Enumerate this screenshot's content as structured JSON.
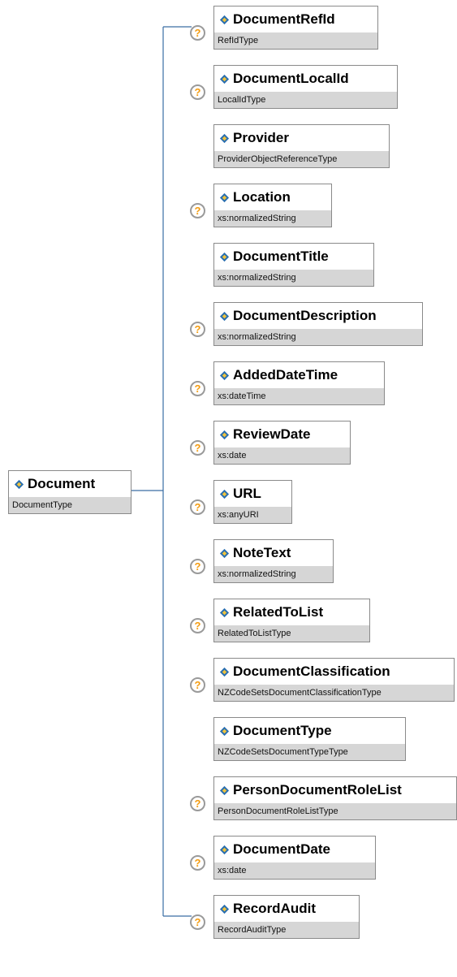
{
  "root": {
    "name": "Document",
    "type": "DocumentType"
  },
  "children": [
    {
      "name": "DocumentRefId",
      "type": "RefIdType",
      "has_annotation": true
    },
    {
      "name": "DocumentLocalId",
      "type": "LocalIdType",
      "has_annotation": true
    },
    {
      "name": "Provider",
      "type": "ProviderObjectReferenceType",
      "has_annotation": false
    },
    {
      "name": "Location",
      "type": "xs:normalizedString",
      "has_annotation": true
    },
    {
      "name": "DocumentTitle",
      "type": "xs:normalizedString",
      "has_annotation": false
    },
    {
      "name": "DocumentDescription",
      "type": "xs:normalizedString",
      "has_annotation": true
    },
    {
      "name": "AddedDateTime",
      "type": "xs:dateTime",
      "has_annotation": true
    },
    {
      "name": "ReviewDate",
      "type": "xs:date",
      "has_annotation": true
    },
    {
      "name": "URL",
      "type": "xs:anyURI",
      "has_annotation": true
    },
    {
      "name": "NoteText",
      "type": "xs:normalizedString",
      "has_annotation": true
    },
    {
      "name": "RelatedToList",
      "type": "RelatedToListType",
      "has_annotation": true
    },
    {
      "name": "DocumentClassification",
      "type": "NZCodeSetsDocumentClassificationType",
      "has_annotation": true
    },
    {
      "name": "DocumentType",
      "type": "NZCodeSetsDocumentTypeType",
      "has_annotation": false
    },
    {
      "name": "PersonDocumentRoleList",
      "type": "PersonDocumentRoleListType",
      "has_annotation": true
    },
    {
      "name": "DocumentDate",
      "type": "xs:date",
      "has_annotation": true
    },
    {
      "name": "RecordAudit",
      "type": "RecordAuditType",
      "has_annotation": true
    }
  ],
  "annotation_glyph": "?",
  "colors": {
    "connector": "#3a6ea5",
    "type_bar": "#d6d6d6",
    "icon": "#2a6fb0",
    "annotation": "#f39c12"
  }
}
